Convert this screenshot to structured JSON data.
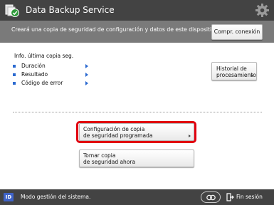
{
  "header": {
    "title": "Data Backup Service",
    "app_icon": "backup-check-icon",
    "settings_icon": "gear-icon"
  },
  "description_bar": {
    "text": "Creará una copia de seguridad de configuración y datos de este dispositivo.",
    "check_connection_button": "Compr. conexión"
  },
  "last_backup_info": {
    "label": "Info. última copia seg.",
    "items": [
      {
        "label": "Duración"
      },
      {
        "label": "Resultado"
      },
      {
        "label": "Código de error"
      }
    ]
  },
  "history_button": {
    "line1": "Historial de",
    "line2": "procesamiento"
  },
  "scheduled_backup_button": {
    "line1": "Configuración de copia",
    "line2": "de seguridad programada"
  },
  "backup_now_button": {
    "line1": "Tomar copia",
    "line2": "de seguridad ahora"
  },
  "status_bar": {
    "badge": "ID",
    "mode_text": "Modo gestión del sistema.",
    "keys_icon": "key-switch-icon",
    "logout_label": "Fin sesión"
  },
  "colors": {
    "title_bar": "#434343",
    "description_bar": "#7a7a7a",
    "highlight": "#e1000f",
    "accent_blue": "#2b6ad0",
    "id_badge": "#3f63c8"
  }
}
